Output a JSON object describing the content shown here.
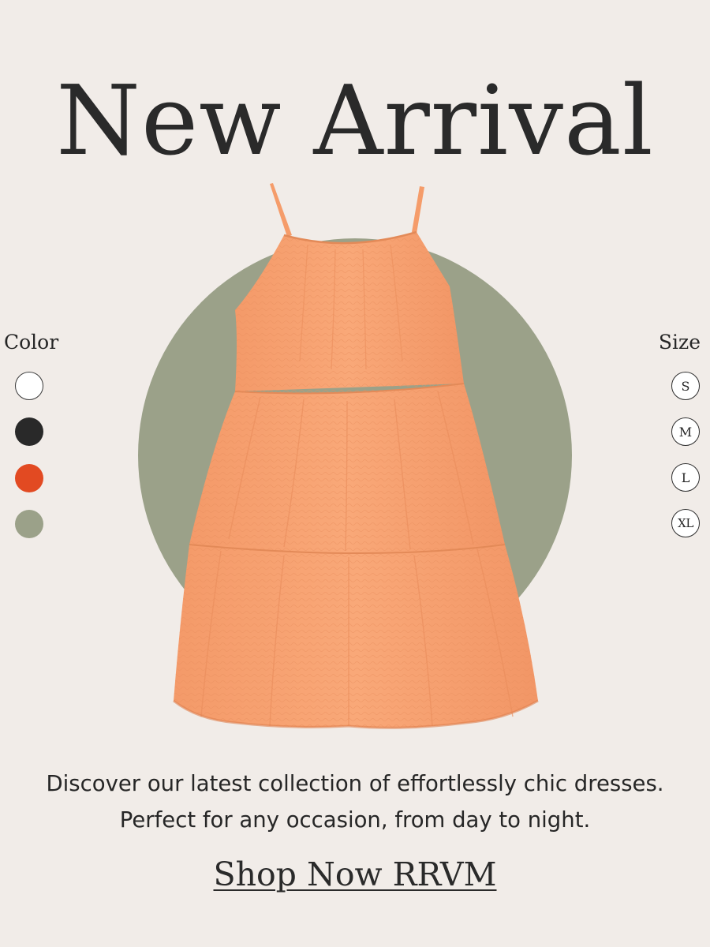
{
  "headline": "New Arrival",
  "product": {
    "icon": "dress-icon",
    "color": "#f7a070"
  },
  "backdrop_color": "#9ba189",
  "color_picker": {
    "label": "Color",
    "options": [
      {
        "name": "white",
        "hex": "#ffffff"
      },
      {
        "name": "black",
        "hex": "#292929"
      },
      {
        "name": "orange",
        "hex": "#e24a22"
      },
      {
        "name": "sage",
        "hex": "#9ba189"
      }
    ]
  },
  "size_picker": {
    "label": "Size",
    "options": [
      "S",
      "M",
      "L",
      "XL"
    ]
  },
  "description": "Discover our latest collection of effortlessly chic dresses. Perfect for any occasion, from day to night.",
  "cta": "Shop Now RRVM"
}
